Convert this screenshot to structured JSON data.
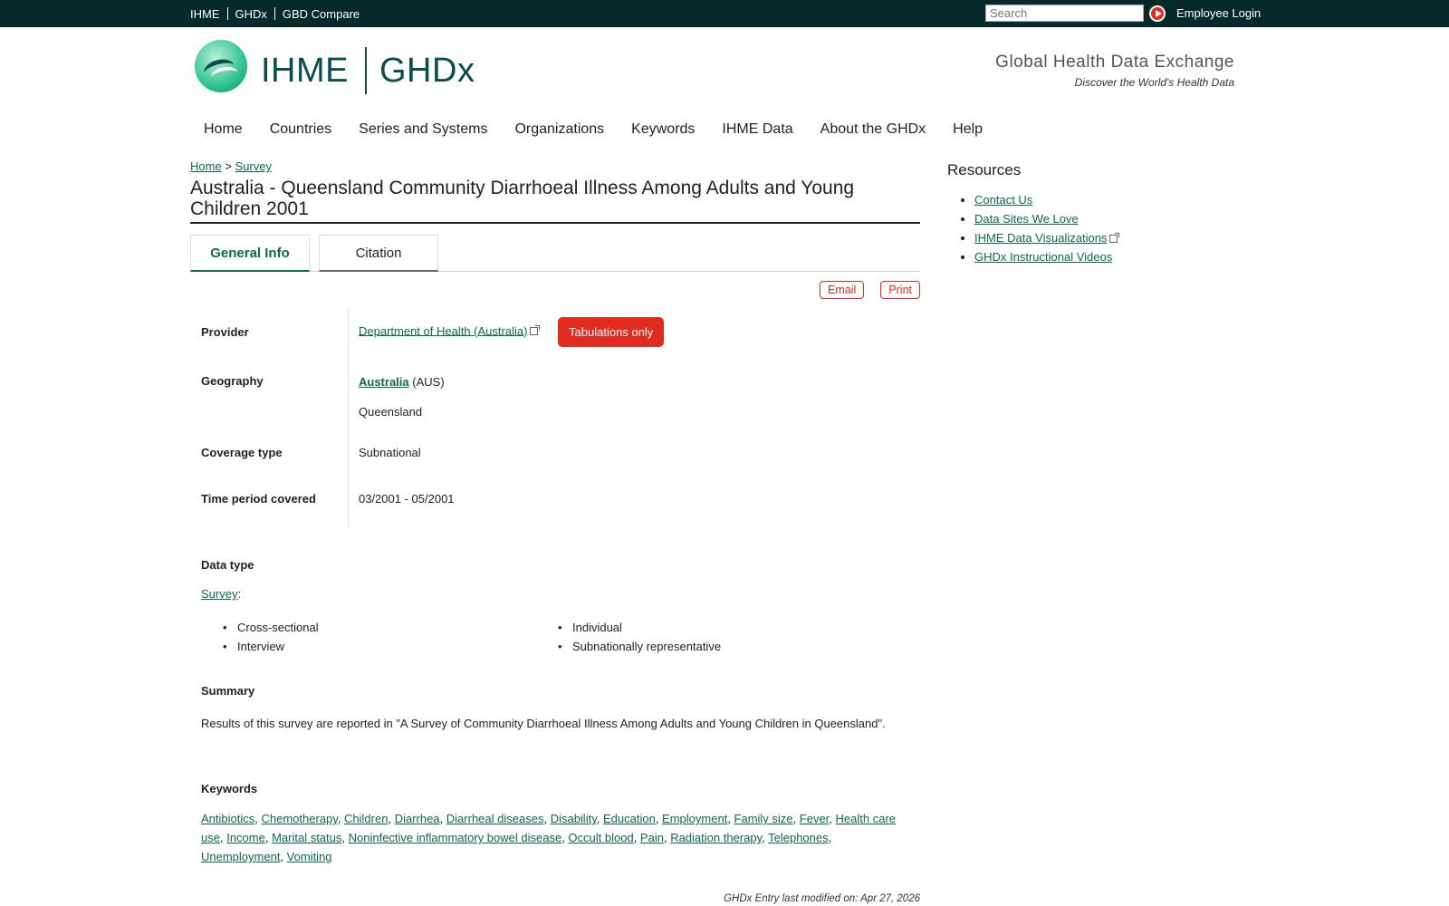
{
  "topbar": {
    "links": [
      "IHME",
      "GHDx",
      "GBD Compare"
    ],
    "search_placeholder": "Search",
    "login": "Employee Login"
  },
  "header": {
    "logo_left": "IHME",
    "logo_right": "GHDx",
    "tagline_title": "Global Health Data Exchange",
    "tagline_sub": "Discover the World's Health Data"
  },
  "nav": [
    "Home",
    "Countries",
    "Series and Systems",
    "Organizations",
    "Keywords",
    "IHME Data",
    "About the GHDx",
    "Help"
  ],
  "breadcrumb": {
    "home": "Home",
    "sep": ">",
    "current": "Survey"
  },
  "page_title": "Australia - Queensland Community Diarrhoeal Illness Among Adults and Young Children 2001",
  "tabs": {
    "general": "General Info",
    "citation": "Citation"
  },
  "actions": {
    "email": "Email",
    "print": "Print"
  },
  "info": {
    "provider_label": "Provider",
    "provider_value": "Department of Health (Australia)",
    "provider_badge": "Tabulations only",
    "geography_label": "Geography",
    "geography_country": "Australia",
    "geography_code": "(AUS)",
    "geography_region": "Queensland",
    "coverage_label": "Coverage type",
    "coverage_value": "Subnational",
    "time_label": "Time period covered",
    "time_value": "03/2001 - 05/2001"
  },
  "data_type": {
    "label": "Data type",
    "survey_link": "Survey",
    "survey_suffix": ":",
    "col1": [
      "Cross-sectional",
      "Interview"
    ],
    "col2": [
      "Individual",
      "Subnationally representative"
    ]
  },
  "summary": {
    "label": "Summary",
    "text": "Results of this survey are reported in \"A Survey of Community Diarrhoeal Illness Among Adults and Young Children in Queensland\"."
  },
  "keywords": {
    "label": "Keywords",
    "items": [
      "Antibiotics",
      "Chemotherapy",
      "Children",
      "Diarrhea",
      "Diarrheal diseases",
      "Disability",
      "Education",
      "Employment",
      "Family size",
      "Fever",
      "Health care use",
      "Income",
      "Marital status",
      "Noninfective inflammatory bowel disease",
      "Occult blood",
      "Pain",
      "Radiation therapy",
      "Telephones",
      "Unemployment",
      "Vomiting"
    ]
  },
  "footer_note": "GHDx Entry last modified on: Apr 27, 2026",
  "sidebar": {
    "title": "Resources",
    "items": [
      "Contact Us",
      "Data Sites We Love",
      "IHME Data Visualizations",
      "GHDx Instructional Videos"
    ]
  }
}
